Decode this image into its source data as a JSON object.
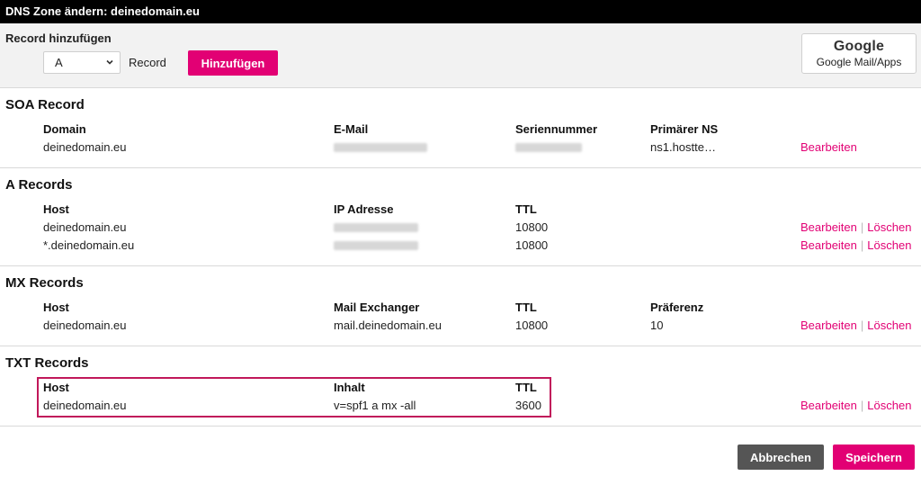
{
  "window": {
    "title": "DNS Zone ändern: deinedomain.eu"
  },
  "add_record": {
    "label": "Record hinzufügen",
    "selected_type": "A",
    "type_suffix": "Record",
    "add_button": "Hinzufügen",
    "google_logo": "Google",
    "google_button": "Google Mail/Apps"
  },
  "soa": {
    "title": "SOA Record",
    "headers": {
      "domain": "Domain",
      "email": "E-Mail",
      "serial": "Seriennummer",
      "ns": "Primärer NS"
    },
    "row": {
      "domain": "deinedomain.eu",
      "ns": "ns1.hostte…",
      "edit": "Bearbeiten"
    }
  },
  "a_records": {
    "title": "A Records",
    "headers": {
      "host": "Host",
      "ip": "IP Adresse",
      "ttl": "TTL"
    },
    "rows": [
      {
        "host": "deinedomain.eu",
        "ttl": "10800",
        "edit": "Bearbeiten",
        "delete": "Löschen"
      },
      {
        "host": "*.deinedomain.eu",
        "ttl": "10800",
        "edit": "Bearbeiten",
        "delete": "Löschen"
      }
    ]
  },
  "mx_records": {
    "title": "MX Records",
    "headers": {
      "host": "Host",
      "exchanger": "Mail Exchanger",
      "ttl": "TTL",
      "pref": "Präferenz"
    },
    "rows": [
      {
        "host": "deinedomain.eu",
        "exchanger": "mail.deinedomain.eu",
        "ttl": "10800",
        "pref": "10",
        "edit": "Bearbeiten",
        "delete": "Löschen"
      }
    ]
  },
  "txt_records": {
    "title": "TXT Records",
    "headers": {
      "host": "Host",
      "content": "Inhalt",
      "ttl": "TTL"
    },
    "rows": [
      {
        "host": "deinedomain.eu",
        "content": "v=spf1 a mx -all",
        "ttl": "3600",
        "edit": "Bearbeiten",
        "delete": "Löschen"
      }
    ]
  },
  "footer": {
    "cancel": "Abbrechen",
    "save": "Speichern"
  },
  "colors": {
    "accent": "#e20074",
    "titlebar": "#000000",
    "cancel": "#555555",
    "highlight": "#c1185a"
  }
}
